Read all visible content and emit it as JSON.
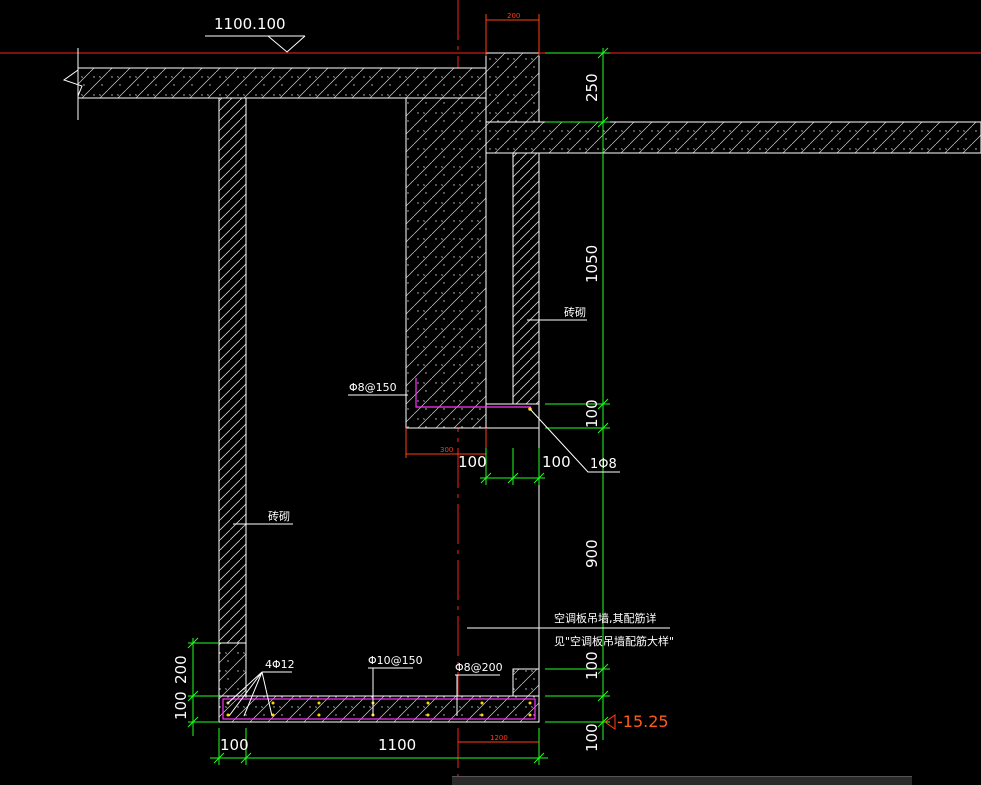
{
  "drawing": {
    "elevation_top_label": "1100.100",
    "elevation_bottom_label": "-15.25",
    "dim_top_red": "200",
    "dim_250": "250",
    "dim_1050": "1050",
    "dim_100_right_a": "100",
    "dim_900": "900",
    "dim_100_right_b": "100",
    "dim_100_right_c": "100",
    "dim_left_200": "200",
    "dim_left_100": "100",
    "dim_bottom_100": "100",
    "dim_bottom_1100": "1100",
    "dim_bottom_red_1200": "1200",
    "dim_red_300": "300",
    "dim_mid_100_left": "100",
    "dim_mid_100_right": "100",
    "label_brick_right": "砖砌",
    "label_brick_left": "砖砌",
    "label_rebar_1": "Φ8@150",
    "label_rebar_2": "1Φ8",
    "label_rebar_3": "4Φ12",
    "label_rebar_4": "Φ10@150",
    "label_rebar_5": "Φ8@200",
    "note_line1": "空调板吊墙,其配筋详",
    "note_line2": "见\"空调板吊墙配筋大样\""
  },
  "colors": {
    "background": "#000000",
    "lines": "#ffffff",
    "dimension": "#20ff20",
    "axis": "#ff2020",
    "rebar": "#ff33ff",
    "elevation_text": "#ff5a1a"
  }
}
